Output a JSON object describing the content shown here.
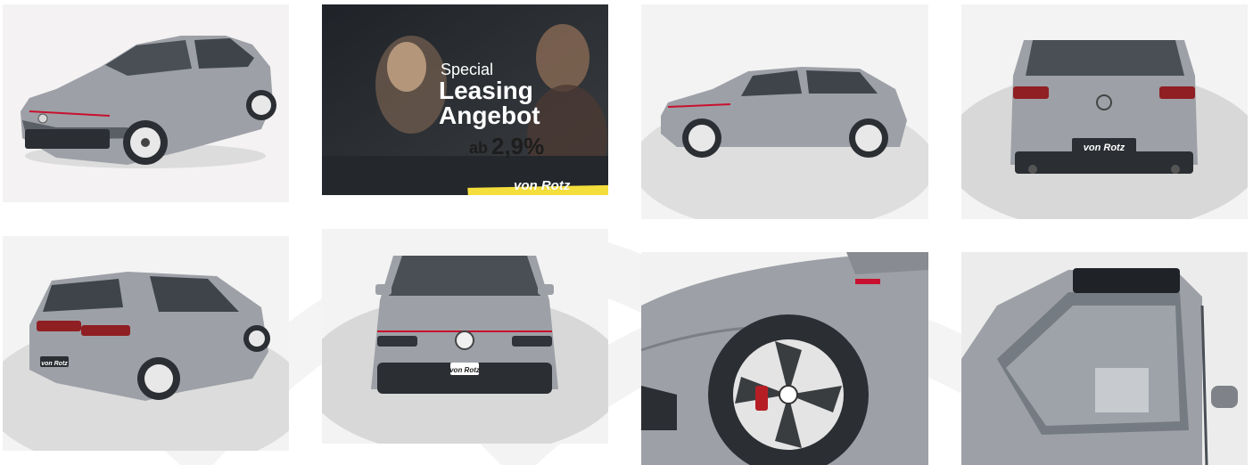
{
  "gallery": {
    "photos": [
      {
        "name": "photo-front-left-three-quarter",
        "body_color": "#9da0a6"
      },
      {
        "name": "photo-promo-banner"
      },
      {
        "name": "photo-side-profile",
        "body_color": "#9da0a6"
      },
      {
        "name": "photo-rear",
        "body_color": "#9da0a6"
      },
      {
        "name": "photo-rear-left-three-quarter",
        "body_color": "#9da0a6"
      },
      {
        "name": "photo-front",
        "body_color": "#9da0a6"
      },
      {
        "name": "photo-wheel-closeup",
        "body_color": "#9da0a6"
      },
      {
        "name": "photo-sunroof-windshield",
        "body_color": "#9da0a6"
      }
    ]
  },
  "promo": {
    "line1": "Special",
    "line2": "Leasing",
    "line3": "Angebot",
    "prefix": "ab",
    "rate": "2,9%",
    "brand": "von Rotz",
    "tag_color": "#f4de3c"
  },
  "plates": {
    "rear": "von Rotz",
    "front": "von Rotz",
    "rear_quarter": "von Rotz"
  },
  "colors": {
    "car_body": "#9da0a6",
    "accent_red": "#c8102e",
    "banner_dark": "#2b2e33"
  }
}
